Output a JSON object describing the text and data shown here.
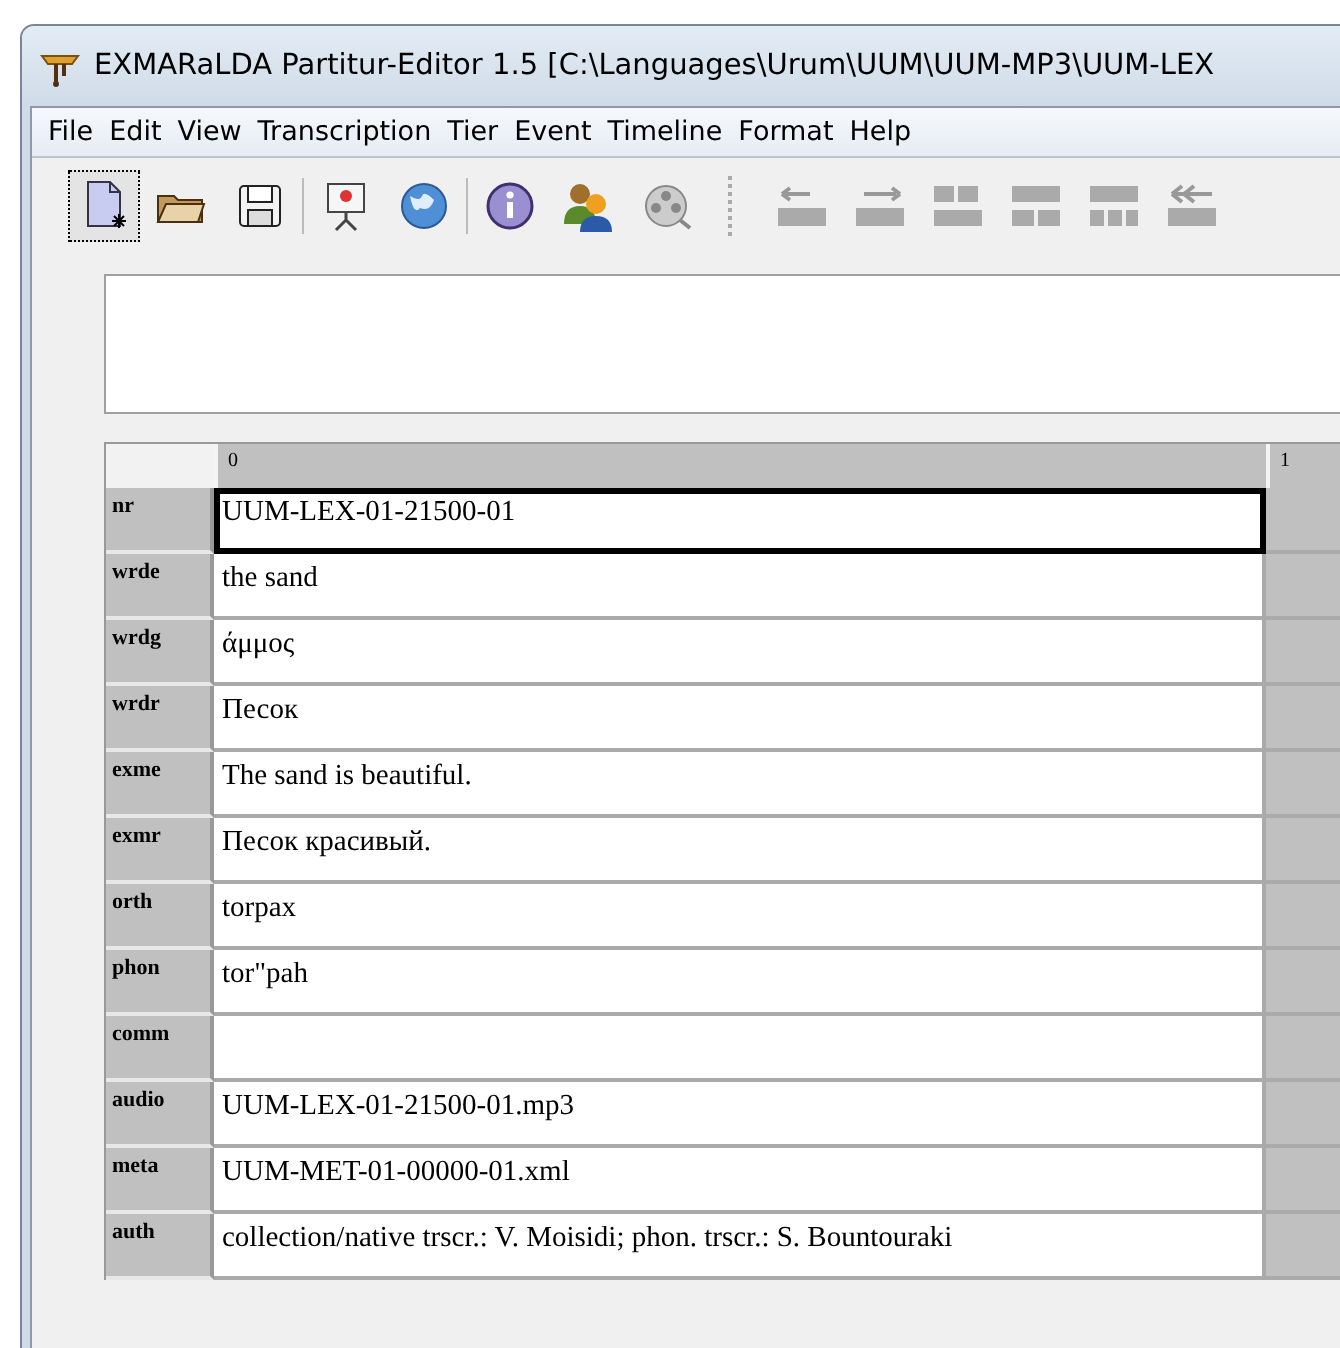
{
  "window": {
    "title": "EXMARaLDA Partitur-Editor 1.5 [C:\\Languages\\Urum\\UUM\\UUM-MP3\\UUM-LEX"
  },
  "menu": [
    {
      "label": "File"
    },
    {
      "label": "Edit"
    },
    {
      "label": "View"
    },
    {
      "label": "Transcription"
    },
    {
      "label": "Tier"
    },
    {
      "label": "Event"
    },
    {
      "label": "Timeline"
    },
    {
      "label": "Format"
    },
    {
      "label": "Help"
    }
  ],
  "toolbar": [
    {
      "kind": "new",
      "selected": true
    },
    {
      "kind": "open",
      "selected": false
    },
    {
      "kind": "save",
      "selected": false
    },
    {
      "kind": "sep"
    },
    {
      "kind": "presentation",
      "selected": false
    },
    {
      "kind": "globe",
      "selected": false
    },
    {
      "kind": "sep"
    },
    {
      "kind": "info",
      "selected": false
    },
    {
      "kind": "speakers",
      "selected": false
    },
    {
      "kind": "reel",
      "selected": false
    },
    {
      "kind": "grip"
    },
    {
      "kind": "move-left",
      "selected": false
    },
    {
      "kind": "move-right",
      "selected": false
    },
    {
      "kind": "merge",
      "selected": false
    },
    {
      "kind": "split",
      "selected": false
    },
    {
      "kind": "split3",
      "selected": false
    },
    {
      "kind": "shift-left",
      "selected": false
    }
  ],
  "partitur": {
    "columns": [
      "0",
      "1"
    ],
    "rows": [
      {
        "tier": "nr",
        "text": "UUM-LEX-01-21500-01",
        "selected": true
      },
      {
        "tier": "wrde",
        "text": "the sand",
        "selected": false
      },
      {
        "tier": "wrdg",
        "text": "άμμος",
        "selected": false
      },
      {
        "tier": "wrdr",
        "text": "Песок",
        "selected": false
      },
      {
        "tier": "exme",
        "text": "The sand is beautiful.",
        "selected": false
      },
      {
        "tier": "exmr",
        "text": "Песок красивый.",
        "selected": false
      },
      {
        "tier": "orth",
        "text": "torpax",
        "selected": false
      },
      {
        "tier": "phon",
        "text": "tor\"pah",
        "selected": false
      },
      {
        "tier": "comm",
        "text": "",
        "selected": false
      },
      {
        "tier": "audio",
        "text": "UUM-LEX-01-21500-01.mp3",
        "selected": false
      },
      {
        "tier": "meta",
        "text": "UUM-MET-01-00000-01.xml",
        "selected": false
      },
      {
        "tier": "auth",
        "text": "collection/native trscr.: V. Moisidi; phon. trscr.: S. Bountouraki",
        "selected": false
      }
    ]
  }
}
